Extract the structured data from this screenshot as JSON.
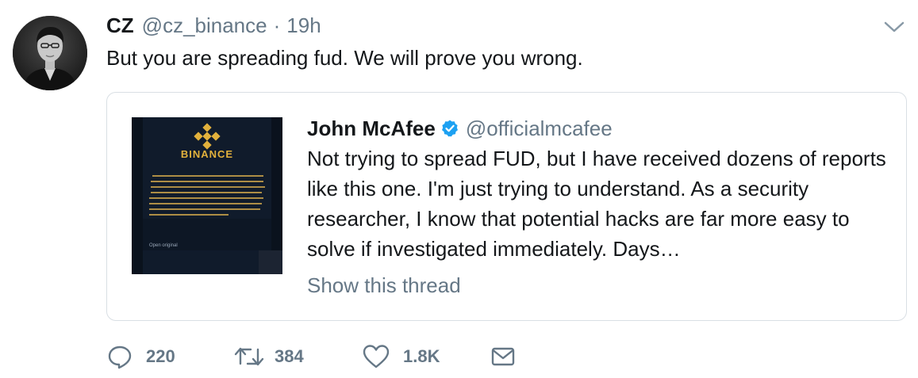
{
  "tweet": {
    "author_name": "CZ",
    "author_handle": "@cz_binance",
    "separator": "·",
    "time": "19h",
    "text": "But you are spreading fud. We will prove you wrong."
  },
  "quoted": {
    "author_name": "John McAfee",
    "author_handle": "@officialmcafee",
    "text": "Not trying to spread FUD, but I have received dozens of reports like this one. I'm just trying to understand. As a security researcher, I know that potential hacks are far more easy to solve if investigated immediately. Days…",
    "show_thread": "Show this thread",
    "image": {
      "brand": "BINANCE",
      "notice": "One of our exchange servers was attacked and compromised a few moments ago. To help minimize potential risk of lost funds for our customers we have had to take the immediate action of halting all exchange activity until we are confident no further customer data and funds have been compromised. We apologize for any inconvenience and we are working diligently to restore service as quickly as possible. We will be in touch with affected customers.",
      "open_original": "Open original"
    }
  },
  "actions": {
    "replies": "220",
    "retweets": "384",
    "likes": "1.8K"
  },
  "icons": {
    "caret": "chevron-down-icon",
    "verified": "verified-badge-icon",
    "reply": "reply-icon",
    "retweet": "retweet-icon",
    "like": "heart-icon",
    "dm": "envelope-icon"
  },
  "colors": {
    "text": "#14171a",
    "secondary": "#657786",
    "verified": "#1da1f2",
    "border": "#d9dfe4"
  }
}
